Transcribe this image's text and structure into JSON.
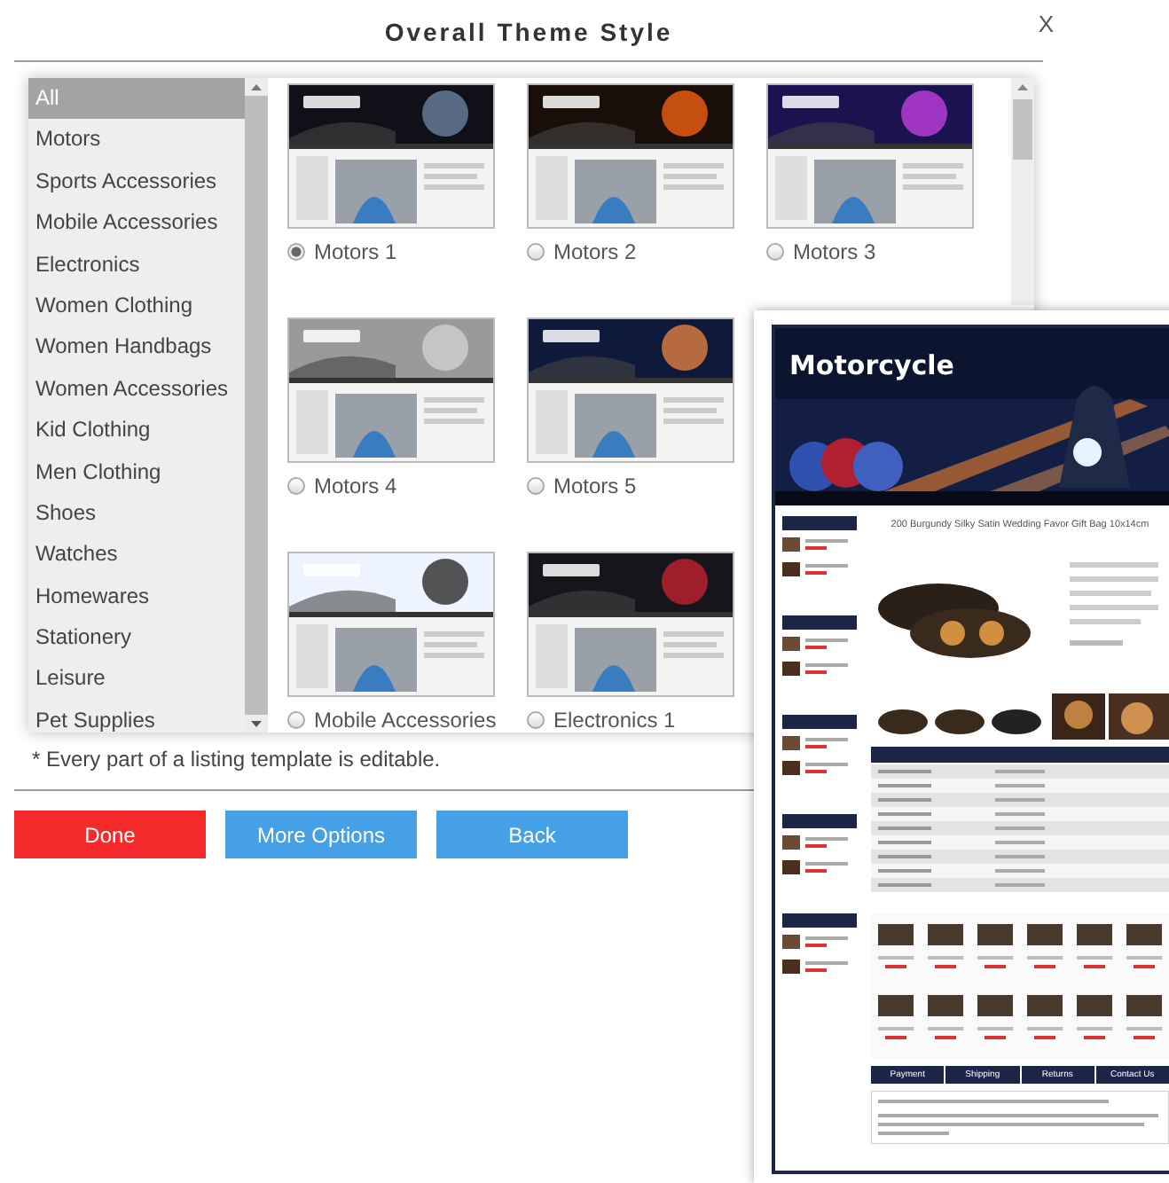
{
  "dialog": {
    "title": "Overall Theme Style",
    "close": "X"
  },
  "categories": [
    {
      "label": "All",
      "selected": true
    },
    {
      "label": "Motors",
      "selected": false
    },
    {
      "label": "Sports Accessories",
      "selected": false
    },
    {
      "label": "Mobile Accessories",
      "selected": false
    },
    {
      "label": "Electronics",
      "selected": false
    },
    {
      "label": "Women Clothing",
      "selected": false
    },
    {
      "label": "Women Handbags",
      "selected": false
    },
    {
      "label": "Women Accessories",
      "selected": false
    },
    {
      "label": "Kid Clothing",
      "selected": false
    },
    {
      "label": "Men Clothing",
      "selected": false
    },
    {
      "label": "Shoes",
      "selected": false
    },
    {
      "label": "Watches",
      "selected": false
    },
    {
      "label": "Homewares",
      "selected": false
    },
    {
      "label": "Stationery",
      "selected": false
    },
    {
      "label": "Leisure",
      "selected": false
    },
    {
      "label": "Pet Supplies",
      "selected": false
    }
  ],
  "theme_rows": [
    [
      {
        "label": "Motors 1",
        "selected": true,
        "kind": "picture"
      },
      {
        "label": "Motors 2",
        "selected": false,
        "kind": "picture"
      },
      {
        "label": "Motors 3",
        "selected": false,
        "kind": "picture"
      }
    ],
    [
      {
        "label": "Motors 4",
        "selected": false,
        "kind": "picture"
      },
      {
        "label": "Motors 5",
        "selected": false,
        "kind": "picture"
      }
    ],
    [
      {
        "label": "Mobile Accessories",
        "selected": false,
        "kind": "picture"
      },
      {
        "label": "Electronics 1",
        "selected": false,
        "kind": "picture"
      }
    ]
  ],
  "note": "* Every part of a listing template is editable.",
  "buttons": [
    {
      "label": "Done",
      "kind": "primary"
    },
    {
      "label": "More Options",
      "kind": "secondary"
    },
    {
      "label": "Back",
      "kind": "secondary"
    }
  ],
  "preview": {
    "logo": "Motorcycle",
    "product_title": "200 Burgundy Silky Satin Wedding Favor Gift Bag 10x14cm",
    "tabs": [
      "Payment",
      "Shipping",
      "Returns",
      "Contact Us"
    ]
  }
}
